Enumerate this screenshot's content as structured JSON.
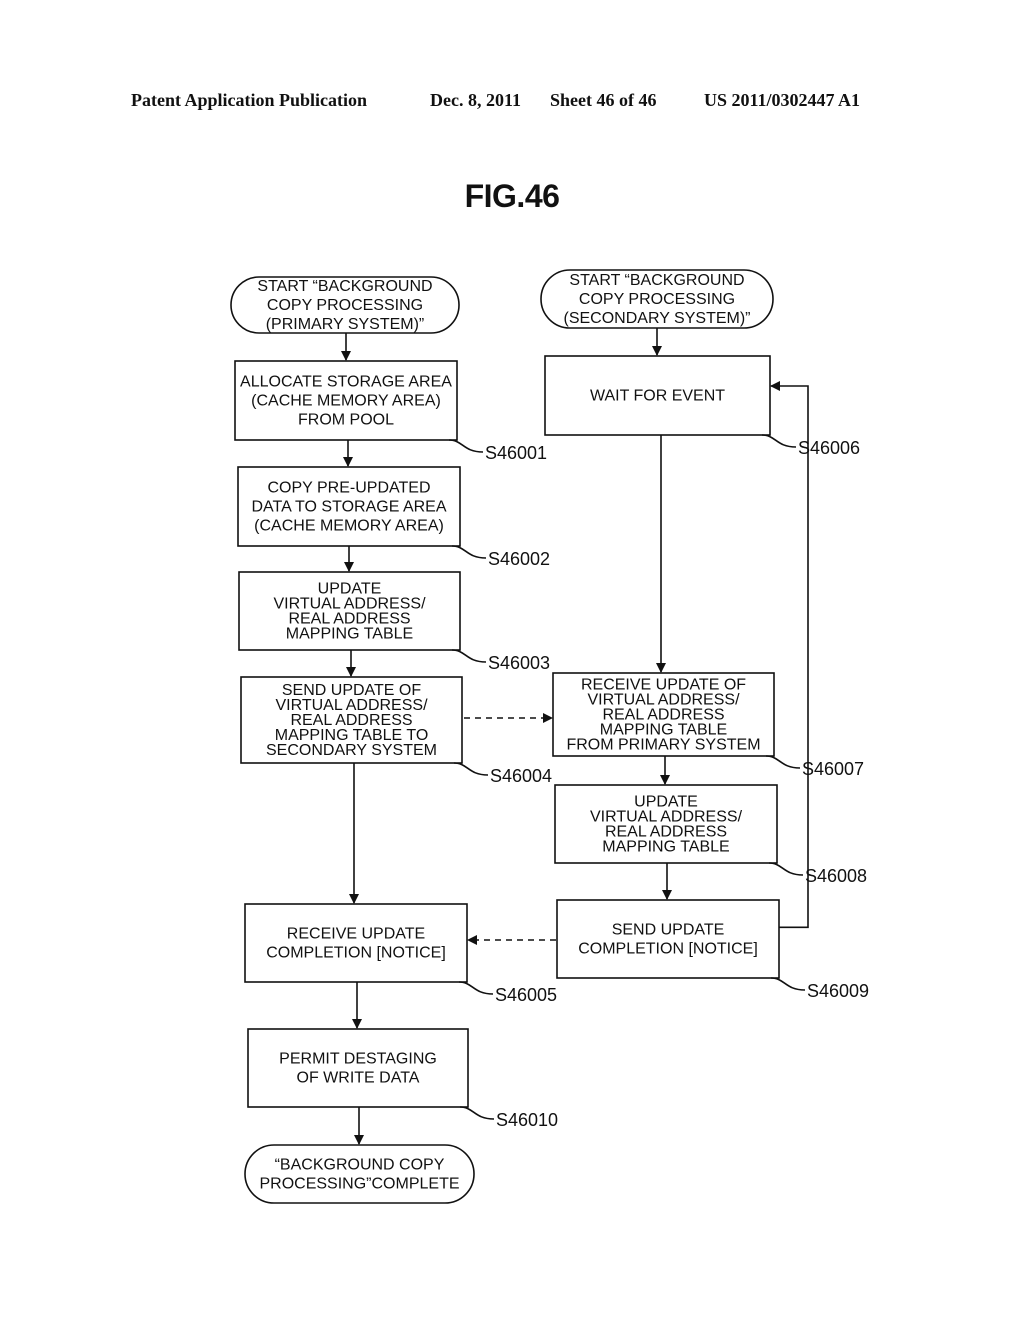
{
  "header": {
    "publication": "Patent Application Publication",
    "date": "Dec. 8, 2011",
    "sheet": "Sheet 46 of 46",
    "number": "US 2011/0302447 A1"
  },
  "figure": {
    "title": "FIG.46"
  },
  "flowchart": {
    "nodes": [
      {
        "id": "start_primary",
        "shape": "terminal",
        "lines": [
          "START “BACKGROUND",
          "COPY PROCESSING",
          "(PRIMARY SYSTEM)”"
        ],
        "step": ""
      },
      {
        "id": "s46001",
        "shape": "process",
        "lines": [
          "ALLOCATE STORAGE AREA",
          "(CACHE MEMORY AREA)",
          "FROM POOL"
        ],
        "step": "S46001"
      },
      {
        "id": "s46002",
        "shape": "process",
        "lines": [
          "COPY PRE-UPDATED",
          "DATA TO STORAGE AREA",
          "(CACHE MEMORY AREA)"
        ],
        "step": "S46002"
      },
      {
        "id": "s46003",
        "shape": "process",
        "lines": [
          "UPDATE",
          "VIRTUAL ADDRESS/",
          "REAL ADDRESS",
          "MAPPING TABLE"
        ],
        "step": "S46003"
      },
      {
        "id": "s46004",
        "shape": "process",
        "lines": [
          "SEND UPDATE OF",
          "VIRTUAL ADDRESS/",
          "REAL ADDRESS",
          "MAPPING TABLE TO",
          "SECONDARY SYSTEM"
        ],
        "step": "S46004"
      },
      {
        "id": "s46005",
        "shape": "process",
        "lines": [
          "RECEIVE UPDATE",
          "COMPLETION [NOTICE]"
        ],
        "step": "S46005"
      },
      {
        "id": "s46010",
        "shape": "process",
        "lines": [
          "PERMIT DESTAGING",
          "OF WRITE DATA"
        ],
        "step": "S46010"
      },
      {
        "id": "end_primary",
        "shape": "terminal",
        "lines": [
          "“BACKGROUND COPY",
          "PROCESSING”COMPLETE"
        ],
        "step": ""
      },
      {
        "id": "start_secondary",
        "shape": "terminal",
        "lines": [
          "START “BACKGROUND",
          "COPY PROCESSING",
          "(SECONDARY SYSTEM)”"
        ],
        "step": ""
      },
      {
        "id": "s46006",
        "shape": "process",
        "lines": [
          "WAIT FOR EVENT"
        ],
        "step": "S46006"
      },
      {
        "id": "s46007",
        "shape": "process",
        "lines": [
          "RECEIVE UPDATE OF",
          "VIRTUAL ADDRESS/",
          "REAL ADDRESS",
          "MAPPING TABLE",
          "FROM PRIMARY SYSTEM"
        ],
        "step": "S46007"
      },
      {
        "id": "s46008",
        "shape": "process",
        "lines": [
          "UPDATE",
          "VIRTUAL ADDRESS/",
          "REAL ADDRESS",
          "MAPPING TABLE"
        ],
        "step": "S46008"
      },
      {
        "id": "s46009",
        "shape": "process",
        "lines": [
          "SEND UPDATE",
          "COMPLETION [NOTICE]"
        ],
        "step": "S46009"
      }
    ],
    "edges": [
      {
        "from": "start_primary",
        "to": "s46001",
        "style": "solid"
      },
      {
        "from": "s46001",
        "to": "s46002",
        "style": "solid"
      },
      {
        "from": "s46002",
        "to": "s46003",
        "style": "solid"
      },
      {
        "from": "s46003",
        "to": "s46004",
        "style": "solid"
      },
      {
        "from": "s46004",
        "to": "s46005",
        "style": "solid"
      },
      {
        "from": "s46005",
        "to": "s46010",
        "style": "solid"
      },
      {
        "from": "s46010",
        "to": "end_primary",
        "style": "solid"
      },
      {
        "from": "start_secondary",
        "to": "s46006",
        "style": "solid"
      },
      {
        "from": "s46006",
        "to": "s46007",
        "style": "solid"
      },
      {
        "from": "s46007",
        "to": "s46008",
        "style": "solid"
      },
      {
        "from": "s46008",
        "to": "s46009",
        "style": "solid"
      },
      {
        "from": "s46009",
        "to": "s46006",
        "style": "solid"
      },
      {
        "from": "s46004",
        "to": "s46007",
        "style": "dashed"
      },
      {
        "from": "s46009",
        "to": "s46005",
        "style": "dashed"
      }
    ]
  }
}
